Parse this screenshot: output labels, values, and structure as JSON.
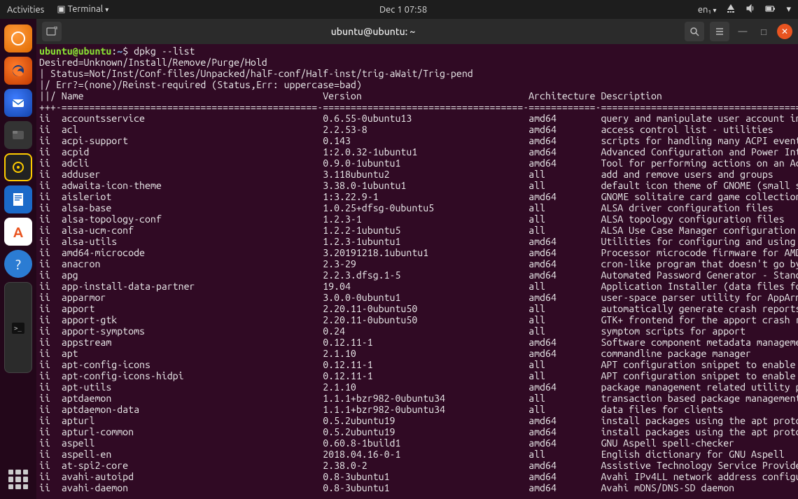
{
  "topbar": {
    "activities": "Activities",
    "app": "Terminal",
    "clock": "Dec 1  07:58",
    "lang": "en₁"
  },
  "window": {
    "title": "ubuntu@ubuntu: ~"
  },
  "prompt": {
    "user_host": "ubuntu@ubuntu",
    "path": "~",
    "command": "dpkg --list"
  },
  "header_lines": [
    "Desired=Unknown/Install/Remove/Purge/Hold",
    "| Status=Not/Inst/Conf-files/Unpacked/halF-conf/Half-inst/trig-aWait/Trig-pend",
    "|/ Err?=(none)/Reinst-required (Status,Err: uppercase=bad)"
  ],
  "columns": {
    "name": "Name",
    "version": "Version",
    "arch": "Architecture",
    "desc": "Description"
  },
  "packages": [
    {
      "s": "ii",
      "n": "accountsservice",
      "v": "0.6.55-0ubuntu13",
      "a": "amd64",
      "d": "query and manipulate user account inf>"
    },
    {
      "s": "ii",
      "n": "acl",
      "v": "2.2.53-8",
      "a": "amd64",
      "d": "access control list - utilities"
    },
    {
      "s": "ii",
      "n": "acpi-support",
      "v": "0.143",
      "a": "amd64",
      "d": "scripts for handling many ACPI events"
    },
    {
      "s": "ii",
      "n": "acpid",
      "v": "1:2.0.32-1ubuntu1",
      "a": "amd64",
      "d": "Advanced Configuration and Power Inte>"
    },
    {
      "s": "ii",
      "n": "adcli",
      "v": "0.9.0-1ubuntu1",
      "a": "amd64",
      "d": "Tool for performing actions on an Act>"
    },
    {
      "s": "ii",
      "n": "adduser",
      "v": "3.118ubuntu2",
      "a": "all",
      "d": "add and remove users and groups"
    },
    {
      "s": "ii",
      "n": "adwaita-icon-theme",
      "v": "3.38.0-1ubuntu1",
      "a": "all",
      "d": "default icon theme of GNOME (small su>"
    },
    {
      "s": "ii",
      "n": "aisleriot",
      "v": "1:3.22.9-1",
      "a": "amd64",
      "d": "GNOME solitaire card game collection"
    },
    {
      "s": "ii",
      "n": "alsa-base",
      "v": "1.0.25+dfsg-0ubuntu5",
      "a": "all",
      "d": "ALSA driver configuration files"
    },
    {
      "s": "ii",
      "n": "alsa-topology-conf",
      "v": "1.2.3-1",
      "a": "all",
      "d": "ALSA topology configuration files"
    },
    {
      "s": "ii",
      "n": "alsa-ucm-conf",
      "v": "1.2.2-1ubuntu5",
      "a": "all",
      "d": "ALSA Use Case Manager configuration f>"
    },
    {
      "s": "ii",
      "n": "alsa-utils",
      "v": "1.2.3-1ubuntu1",
      "a": "amd64",
      "d": "Utilities for configuring and using A>"
    },
    {
      "s": "ii",
      "n": "amd64-microcode",
      "v": "3.20191218.1ubuntu1",
      "a": "amd64",
      "d": "Processor microcode firmware for AMD >"
    },
    {
      "s": "ii",
      "n": "anacron",
      "v": "2.3-29",
      "a": "amd64",
      "d": "cron-like program that doesn't go by >"
    },
    {
      "s": "ii",
      "n": "apg",
      "v": "2.2.3.dfsg.1-5",
      "a": "amd64",
      "d": "Automated Password Generator - Standa>"
    },
    {
      "s": "ii",
      "n": "app-install-data-partner",
      "v": "19.04",
      "a": "all",
      "d": "Application Installer (data files for>"
    },
    {
      "s": "ii",
      "n": "apparmor",
      "v": "3.0.0-0ubuntu1",
      "a": "amd64",
      "d": "user-space parser utility for AppArmor"
    },
    {
      "s": "ii",
      "n": "apport",
      "v": "2.20.11-0ubuntu50",
      "a": "all",
      "d": "automatically generate crash reports >"
    },
    {
      "s": "ii",
      "n": "apport-gtk",
      "v": "2.20.11-0ubuntu50",
      "a": "all",
      "d": "GTK+ frontend for the apport crash re>"
    },
    {
      "s": "ii",
      "n": "apport-symptoms",
      "v": "0.24",
      "a": "all",
      "d": "symptom scripts for apport"
    },
    {
      "s": "ii",
      "n": "appstream",
      "v": "0.12.11-1",
      "a": "amd64",
      "d": "Software component metadata management"
    },
    {
      "s": "ii",
      "n": "apt",
      "v": "2.1.10",
      "a": "amd64",
      "d": "commandline package manager"
    },
    {
      "s": "ii",
      "n": "apt-config-icons",
      "v": "0.12.11-1",
      "a": "all",
      "d": "APT configuration snippet to enable i>"
    },
    {
      "s": "ii",
      "n": "apt-config-icons-hidpi",
      "v": "0.12.11-1",
      "a": "all",
      "d": "APT configuration snippet to enable H>"
    },
    {
      "s": "ii",
      "n": "apt-utils",
      "v": "2.1.10",
      "a": "amd64",
      "d": "package management related utility pr>"
    },
    {
      "s": "ii",
      "n": "aptdaemon",
      "v": "1.1.1+bzr982-0ubuntu34",
      "a": "all",
      "d": "transaction based package management >"
    },
    {
      "s": "ii",
      "n": "aptdaemon-data",
      "v": "1.1.1+bzr982-0ubuntu34",
      "a": "all",
      "d": "data files for clients"
    },
    {
      "s": "ii",
      "n": "apturl",
      "v": "0.5.2ubuntu19",
      "a": "amd64",
      "d": "install packages using the apt protoc>"
    },
    {
      "s": "ii",
      "n": "apturl-common",
      "v": "0.5.2ubuntu19",
      "a": "amd64",
      "d": "install packages using the apt protoc>"
    },
    {
      "s": "ii",
      "n": "aspell",
      "v": "0.60.8-1build1",
      "a": "amd64",
      "d": "GNU Aspell spell-checker"
    },
    {
      "s": "ii",
      "n": "aspell-en",
      "v": "2018.04.16-0-1",
      "a": "all",
      "d": "English dictionary for GNU Aspell"
    },
    {
      "s": "ii",
      "n": "at-spi2-core",
      "v": "2.38.0-2",
      "a": "amd64",
      "d": "Assistive Technology Service Provider>"
    },
    {
      "s": "ii",
      "n": "avahi-autoipd",
      "v": "0.8-3ubuntu1",
      "a": "amd64",
      "d": "Avahi IPv4LL network address configur>"
    },
    {
      "s": "ii",
      "n": "avahi-daemon",
      "v": "0.8-3ubuntu1",
      "a": "amd64",
      "d": "Avahi mDNS/DNS-SD daemon"
    }
  ]
}
